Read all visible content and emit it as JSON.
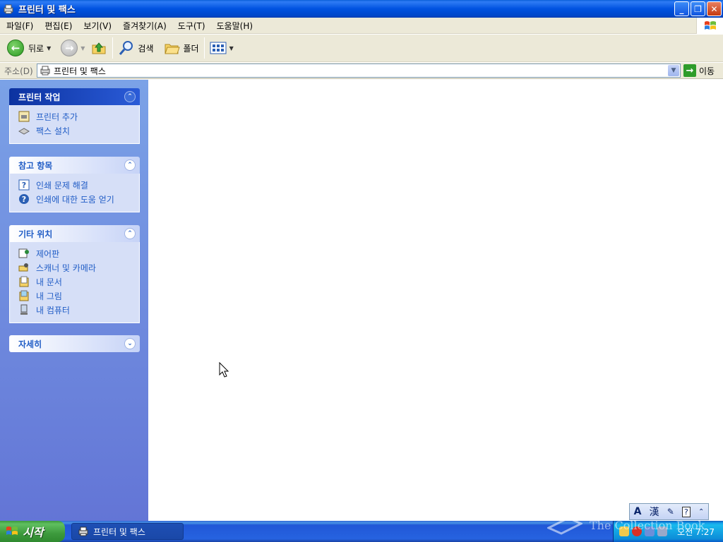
{
  "window": {
    "title": "프린터 및 팩스",
    "buttons": {
      "minimize": "_",
      "restore": "❐",
      "close": "✕"
    }
  },
  "menubar": {
    "items": [
      "파일(F)",
      "편집(E)",
      "보기(V)",
      "즐겨찾기(A)",
      "도구(T)",
      "도움말(H)"
    ]
  },
  "toolbar": {
    "back_label": "뒤로",
    "search_label": "검색",
    "folders_label": "폴더"
  },
  "address": {
    "label": "주소(D)",
    "value": "프린터 및 팩스",
    "go_label": "이동"
  },
  "taskpane": {
    "printer_tasks": {
      "title": "프린터 작업",
      "items": [
        "프린터 추가",
        "팩스 설치"
      ]
    },
    "see_also": {
      "title": "참고 항목",
      "items": [
        "인쇄 문제 해결",
        "인쇄에 대한 도움 얻기"
      ]
    },
    "other_places": {
      "title": "기타 위치",
      "items": [
        "제어판",
        "스캐너 및 카메라",
        "내 문서",
        "내 그림",
        "내 컴퓨터"
      ]
    },
    "details": {
      "title": "자세히"
    }
  },
  "langbar": {
    "mode_a": "A",
    "mode_hanja": "漢"
  },
  "taskbar": {
    "start_label": "시작",
    "window_button": "프린터 및 팩스",
    "clock": "오전 7:27"
  },
  "watermark": "The Collection Book",
  "colors": {
    "title_blue": "#0052e0",
    "pane_link": "#215dc6",
    "taskbar_blue": "#2157d7",
    "start_green": "#3d9a3d"
  }
}
